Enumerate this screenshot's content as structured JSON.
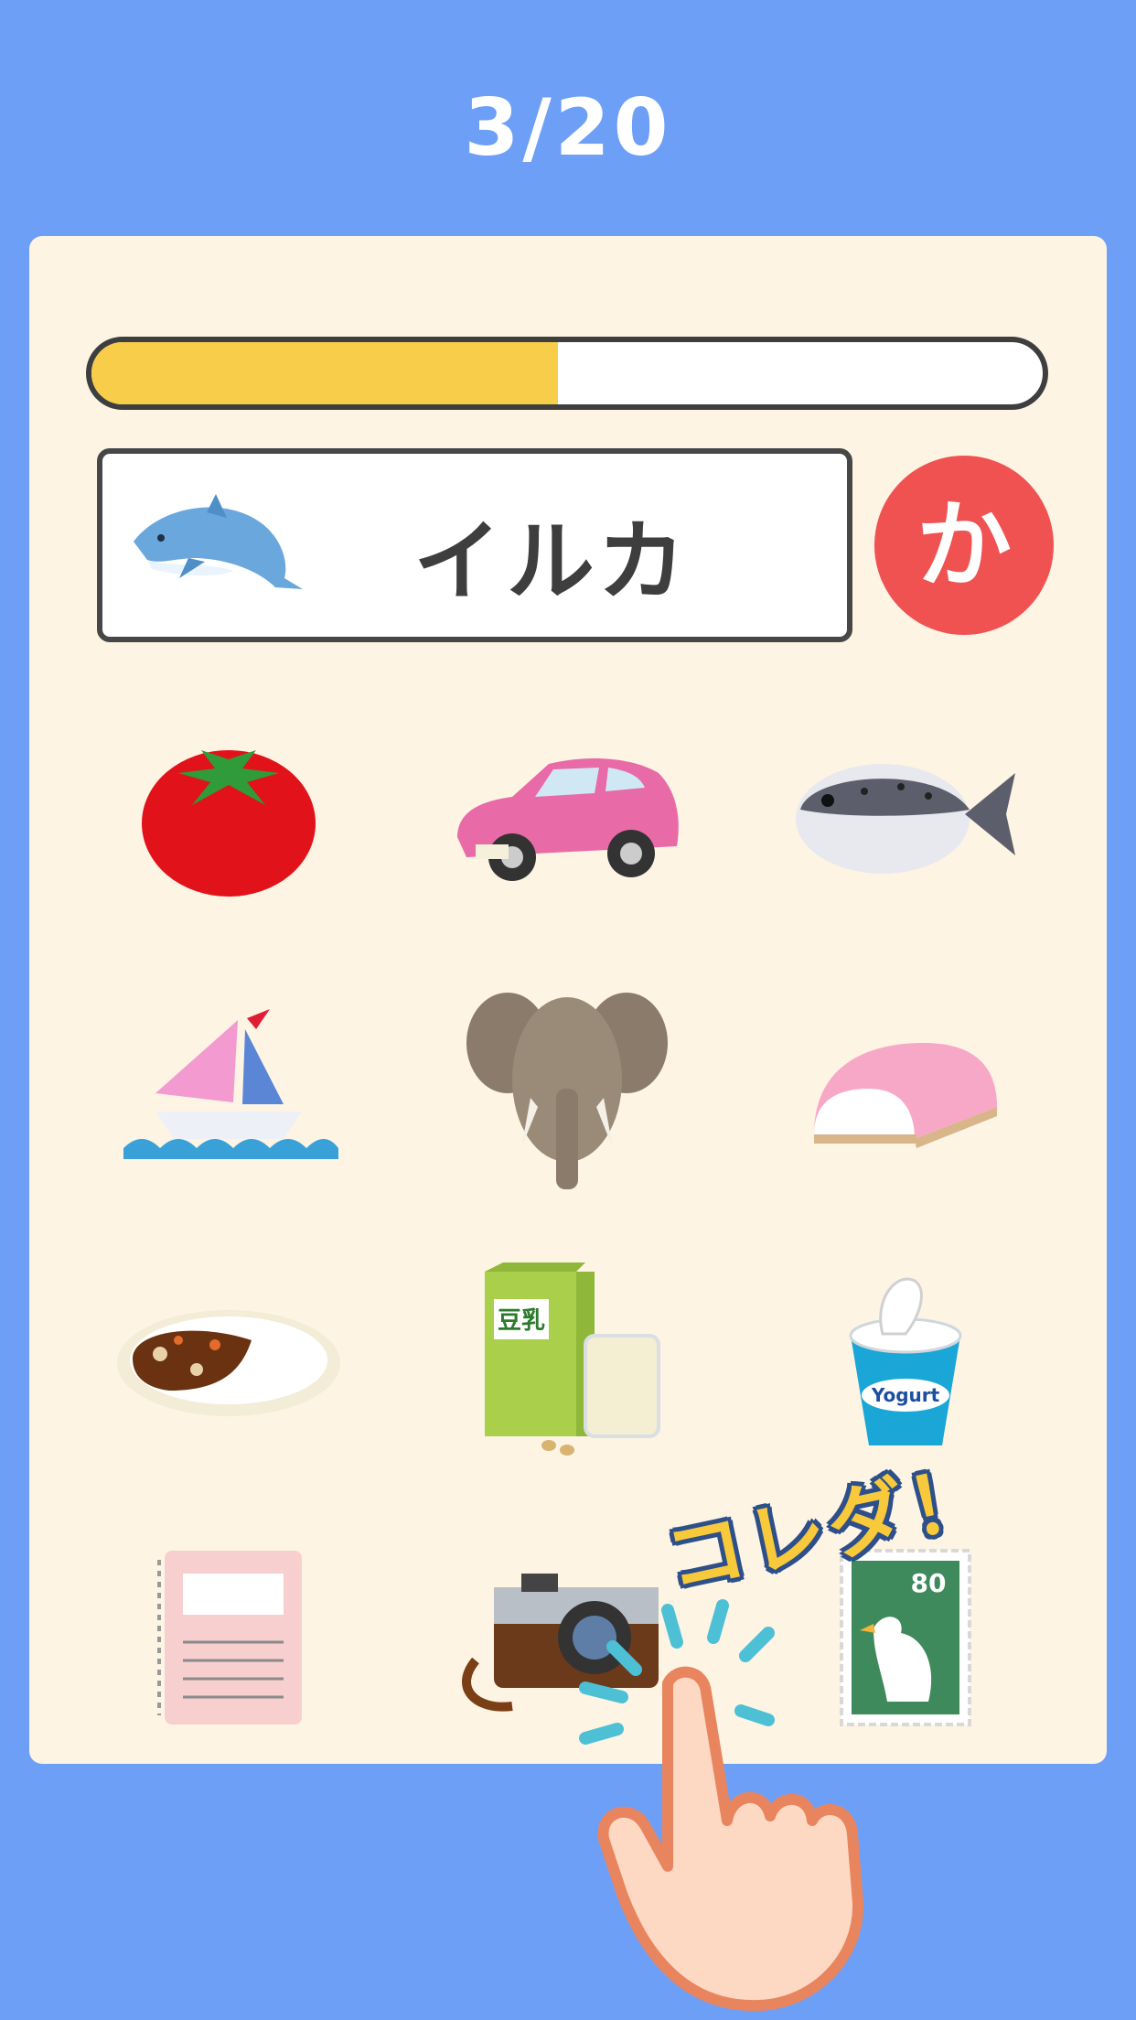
{
  "header": {
    "counter": "3/20"
  },
  "progress": {
    "fraction": 0.49,
    "fill_color": "#f7cd49"
  },
  "question": {
    "word": "イルカ",
    "icon": "dolphin-icon"
  },
  "answer_button": {
    "label": "か",
    "color": "#f05252"
  },
  "choices": [
    {
      "name": "tomato"
    },
    {
      "name": "car"
    },
    {
      "name": "pufferfish"
    },
    {
      "name": "sailboat"
    },
    {
      "name": "elephant"
    },
    {
      "name": "kamaboko"
    },
    {
      "name": "curry-rice"
    },
    {
      "name": "soy-milk",
      "label": "豆乳"
    },
    {
      "name": "yogurt",
      "label": "Yogurt"
    },
    {
      "name": "notebook"
    },
    {
      "name": "camera"
    },
    {
      "name": "stamp",
      "label": "80"
    }
  ],
  "hint": {
    "callout": "コレダ！"
  }
}
